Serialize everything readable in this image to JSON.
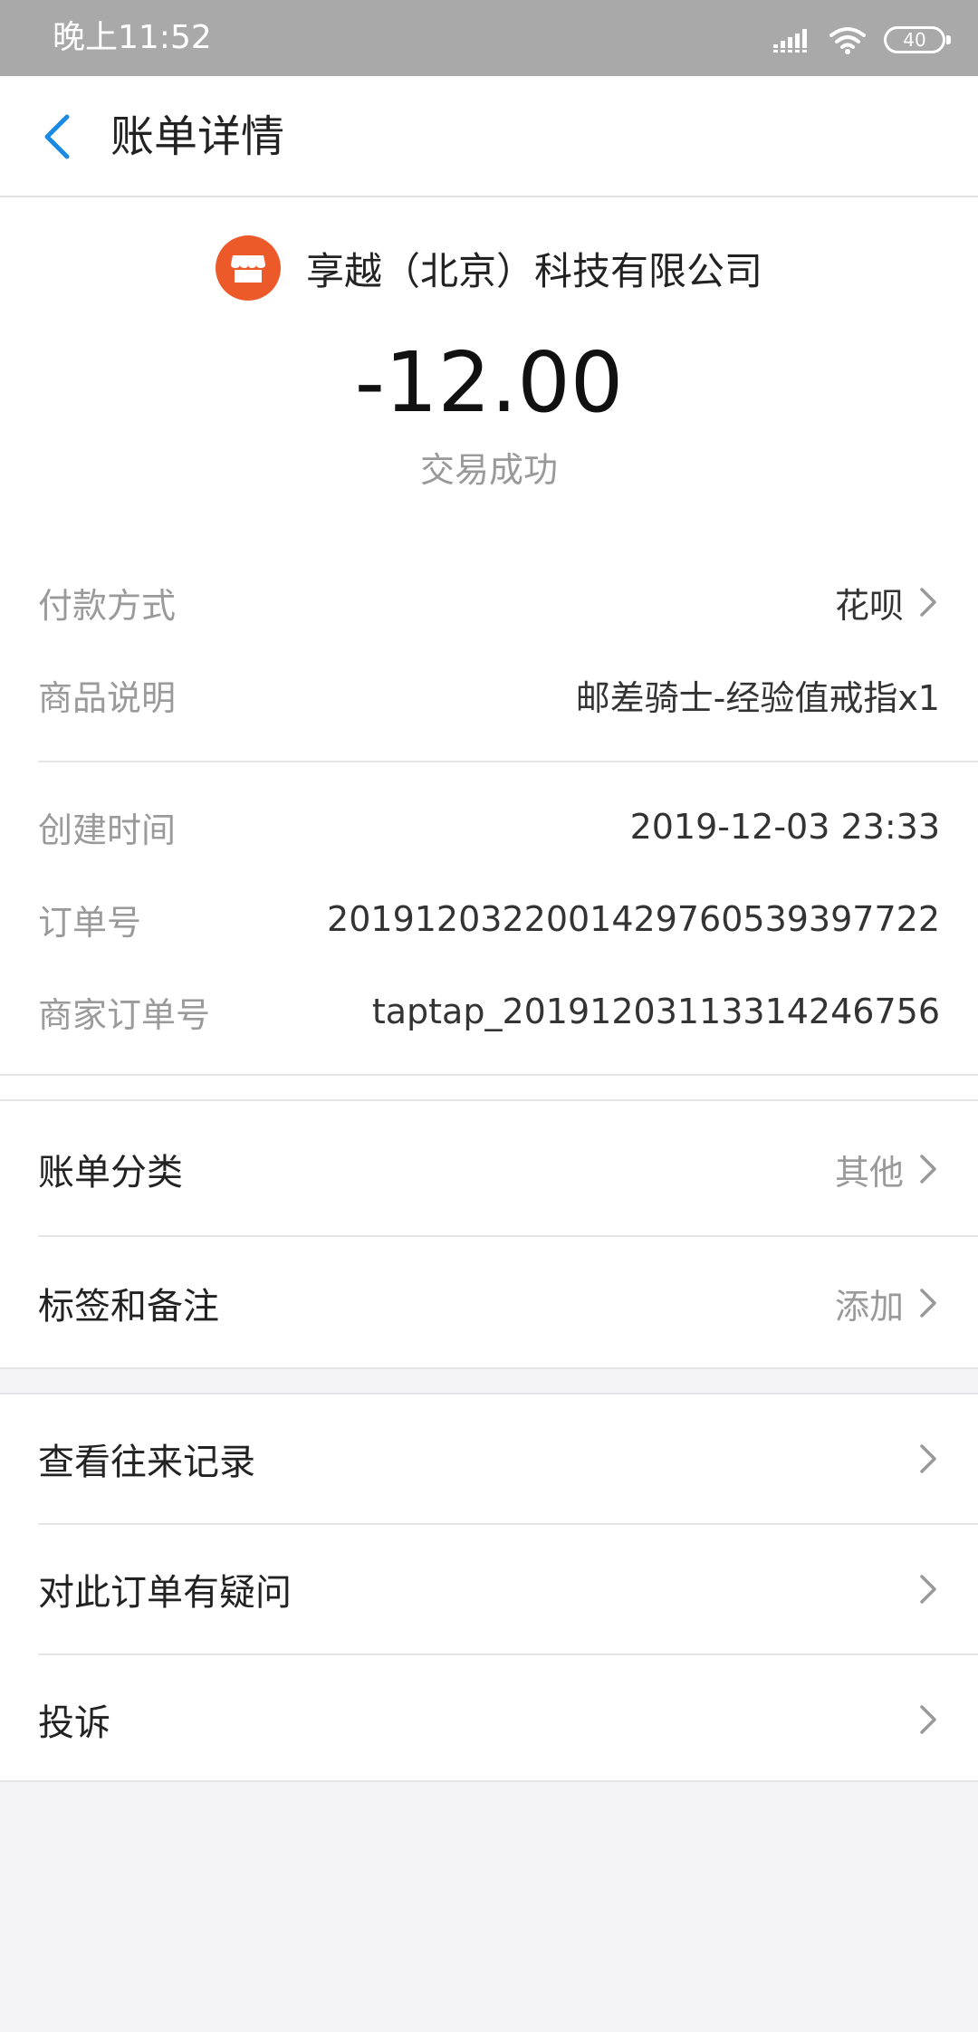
{
  "status_bar": {
    "time": "晚上11:52",
    "battery": "40"
  },
  "nav": {
    "title": "账单详情"
  },
  "merchant": {
    "name": "享越（北京）科技有限公司",
    "amount": "-12.00",
    "status": "交易成功"
  },
  "details_primary": [
    {
      "label": "付款方式",
      "value": "花呗"
    },
    {
      "label": "商品说明",
      "value": "邮差骑士-经验值戒指x1"
    }
  ],
  "details_secondary": [
    {
      "label": "创建时间",
      "value": "2019-12-03 23:33"
    },
    {
      "label": "订单号",
      "value": "2019120322001429760539397722"
    },
    {
      "label": "商家订单号",
      "value": "taptap_20191203113314246756"
    }
  ],
  "category_section": [
    {
      "label": "账单分类",
      "value": "其他"
    },
    {
      "label": "标签和备注",
      "value": "添加"
    }
  ],
  "action_section": [
    {
      "label": "查看往来记录"
    },
    {
      "label": "对此订单有疑问"
    },
    {
      "label": "投诉"
    }
  ],
  "colors": {
    "accent": "#1a8ae5",
    "merchant_logo": "#ec5a2a",
    "background": "#f4f4f8"
  }
}
